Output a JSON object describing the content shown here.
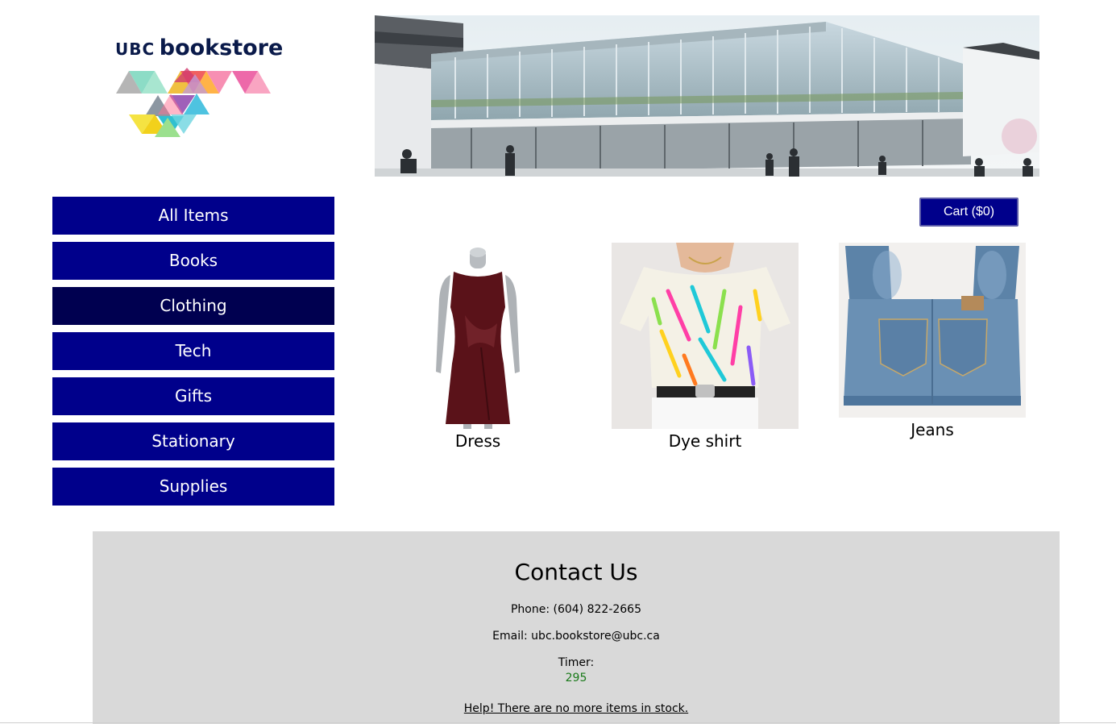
{
  "brand": {
    "ubc": "UBC",
    "name": "bookstore"
  },
  "nav": {
    "items": [
      {
        "label": "All Items"
      },
      {
        "label": "Books"
      },
      {
        "label": "Clothing"
      },
      {
        "label": "Tech"
      },
      {
        "label": "Gifts"
      },
      {
        "label": "Stationary"
      },
      {
        "label": "Supplies"
      }
    ],
    "active": "Clothing"
  },
  "cart": {
    "label": "Cart ($0)"
  },
  "products": [
    {
      "name": "Dress"
    },
    {
      "name": "Dye shirt"
    },
    {
      "name": "Jeans"
    }
  ],
  "footer": {
    "title": "Contact Us",
    "phone": "Phone: (604) 822-2665",
    "email": "Email: ubc.bookstore@ubc.ca",
    "timer_label": "Timer:",
    "timer_value": "295",
    "help_link": "Help! There are no more items in stock."
  },
  "colors": {
    "nav_bg": "#00008b",
    "nav_active": "#000050",
    "footer_bg": "#d9d9d9",
    "timer": "#1a7a1a"
  }
}
